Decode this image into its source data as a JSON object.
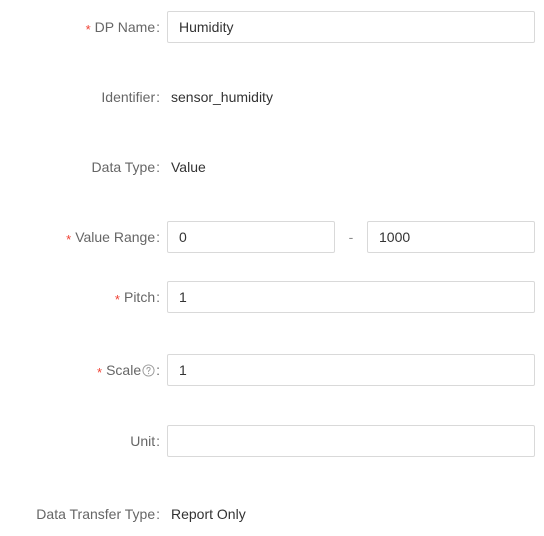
{
  "form": {
    "rows": [
      {
        "key": "dp_name",
        "label": "DP Name",
        "required": true,
        "colon": ":",
        "type": "input",
        "value": "Humidity",
        "placeholder": ""
      },
      {
        "key": "identifier",
        "label": "Identifier",
        "required": false,
        "colon": ":",
        "type": "static",
        "value": "sensor_humidity"
      },
      {
        "key": "data_type",
        "label": "Data Type",
        "required": false,
        "colon": ":",
        "type": "static",
        "value": "Value"
      },
      {
        "key": "value_range",
        "label": "Value Range",
        "required": true,
        "colon": ":",
        "type": "range",
        "min_value": "0",
        "max_value": "1000",
        "separator": "-",
        "min_placeholder": "",
        "max_placeholder": ""
      },
      {
        "key": "pitch",
        "label": "Pitch",
        "required": true,
        "colon": ":",
        "type": "input",
        "value": "1",
        "placeholder": ""
      },
      {
        "key": "scale",
        "label": "Scale",
        "required": true,
        "colon": ":",
        "type": "input",
        "value": "1",
        "placeholder": "",
        "help_icon": "question-circle-icon"
      },
      {
        "key": "unit",
        "label": "Unit",
        "required": false,
        "colon": ":",
        "type": "input",
        "value": "",
        "placeholder": ""
      },
      {
        "key": "data_transfer_type",
        "label": "Data Transfer Type",
        "required": false,
        "colon": ":",
        "type": "static",
        "value": "Report Only"
      }
    ],
    "required_marker": "*"
  },
  "colors": {
    "required_star": "#f04134",
    "label_text": "#666666",
    "value_text": "#333333",
    "input_border": "#d9d9d9",
    "background": "#ffffff",
    "help_icon": "#9a9a9a"
  }
}
